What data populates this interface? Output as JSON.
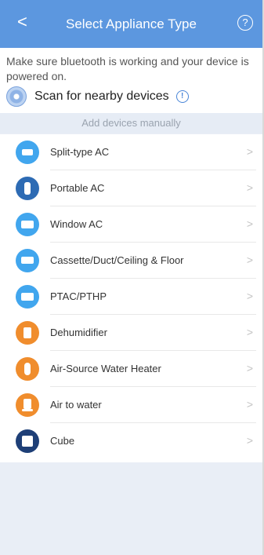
{
  "header": {
    "back_glyph": "<",
    "title": "Select Appliance Type",
    "help_glyph": "?"
  },
  "scan": {
    "message": "Make sure bluetooth is working and your device is powered on.",
    "label": "Scan for nearby devices",
    "info_glyph": "!"
  },
  "manual": {
    "label": "Add devices manually"
  },
  "devices": [
    {
      "label": "Split-type AC",
      "icon": "split-ac-icon",
      "color": "#41a6ee"
    },
    {
      "label": "Portable AC",
      "icon": "portable-ac-icon",
      "color": "#2d6bb4"
    },
    {
      "label": "Window AC",
      "icon": "window-ac-icon",
      "color": "#41a6ee"
    },
    {
      "label": "Cassette/Duct/Ceiling & Floor",
      "icon": "cassette-ac-icon",
      "color": "#41a6ee"
    },
    {
      "label": "PTAC/PTHP",
      "icon": "ptac-icon",
      "color": "#41a6ee"
    },
    {
      "label": "Dehumidifier",
      "icon": "dehumidifier-icon",
      "color": "#f08d2d"
    },
    {
      "label": "Air-Source Water Heater",
      "icon": "water-heater-icon",
      "color": "#f08d2d"
    },
    {
      "label": "Air to water",
      "icon": "air-to-water-icon",
      "color": "#f08d2d"
    },
    {
      "label": "Cube",
      "icon": "cube-icon",
      "color": "#1e3f77"
    }
  ],
  "chevron_glyph": ">"
}
